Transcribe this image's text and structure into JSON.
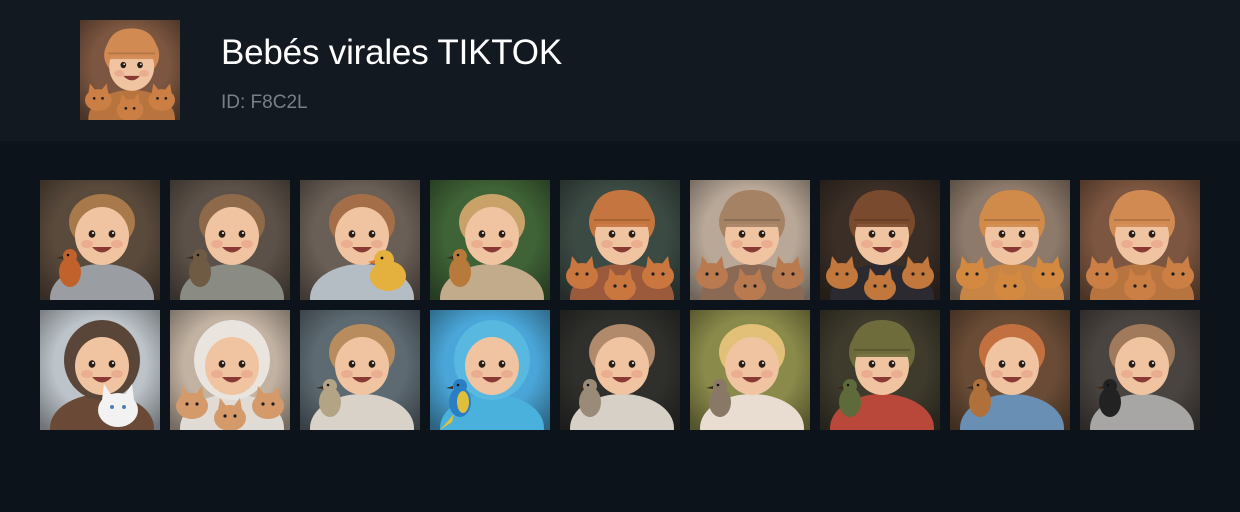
{
  "header": {
    "title": "Bebés virales TIKTOK",
    "id_label": "ID: F8C2L"
  },
  "colors": {
    "page_background": "#0d131a",
    "header_background": "#121920",
    "title_color": "#ffffff",
    "id_color": "#7a7f86"
  },
  "images": [
    {
      "name": "baby-robin",
      "bg": "#5a4a3c",
      "hat": "none",
      "hatColor": "#000000",
      "hair": "#a7794b",
      "cloth": "#9a9da2",
      "animal": "bird",
      "animalColor": "#c1612c"
    },
    {
      "name": "baby-sparrow-hat-none",
      "bg": "#5c5148",
      "hat": "none",
      "hatColor": "#000000",
      "hair": "#8f6a4a",
      "cloth": "#8a8b82",
      "animal": "bird",
      "animalColor": "#6f5a44"
    },
    {
      "name": "baby-chick",
      "bg": "#6a5f56",
      "hat": "none",
      "hatColor": "#000000",
      "hair": "#a46f48",
      "cloth": "#b4bcc4",
      "animal": "chick",
      "animalColor": "#e5b13e"
    },
    {
      "name": "baby-finch-garden",
      "bg": "#3f6236",
      "hat": "none",
      "hatColor": "#000000",
      "hair": "#c9a26a",
      "cloth": "#c2ab8a",
      "animal": "bird",
      "animalColor": "#b87a3a"
    },
    {
      "name": "baby-orange-hat-kittens-snow",
      "bg": "#3c4a44",
      "hat": "beanie",
      "hatColor": "#c5753f",
      "hair": "#c5753f",
      "cloth": "#9c5a3c",
      "animal": "kittens",
      "animalColor": "#c9773e"
    },
    {
      "name": "baby-furry-hat-kittens",
      "bg": "#b9a898",
      "hat": "beanie",
      "hatColor": "#a58264",
      "hair": "#a58264",
      "cloth": "#8a6a55",
      "animal": "kittens",
      "animalColor": "#b87a4e"
    },
    {
      "name": "baby-brown-beanie-kitten",
      "bg": "#3a2e26",
      "hat": "beanie",
      "hatColor": "#7a4a2e",
      "hair": "#7a4a2e",
      "cloth": "#2a2a30",
      "animal": "kittens",
      "animalColor": "#c2773c"
    },
    {
      "name": "baby-orange-beanie-kittens",
      "bg": "#8d7a6a",
      "hat": "beanie",
      "hatColor": "#d08a4a",
      "hair": "#d08a4a",
      "cloth": "#c98546",
      "animal": "kittens",
      "animalColor": "#d38940"
    },
    {
      "name": "baby-orange-hat-kittens",
      "bg": "#7c5640",
      "hat": "beanie",
      "hatColor": "#d08a52",
      "hair": "#d08a52",
      "cloth": "#b8743e",
      "animal": "kittens",
      "animalColor": "#cc7f44"
    },
    {
      "name": "baby-waving-white-kitten",
      "bg": "#bcc3c9",
      "hat": "hood",
      "hatColor": "#5a4638",
      "hair": "#5a4638",
      "cloth": "#6a4a36",
      "animal": "whitecat",
      "animalColor": "#f2f2f2"
    },
    {
      "name": "baby-white-hood-kitten",
      "bg": "#c2b2a2",
      "hat": "hood",
      "hatColor": "#e9e4de",
      "hair": "#e9e4de",
      "cloth": "#e0dbd4",
      "animal": "kittens",
      "animalColor": "#d49a6a"
    },
    {
      "name": "baby-small-bird",
      "bg": "#5d6a72",
      "hat": "none",
      "hatColor": "#000000",
      "hair": "#b88c5c",
      "cloth": "#d8d2c8",
      "animal": "bird",
      "animalColor": "#b3a486"
    },
    {
      "name": "baby-blue-hood-parrot",
      "bg": "#4aa6d8",
      "hat": "hood",
      "hatColor": "#58b8e0",
      "hair": "#58b8e0",
      "cloth": "#4ab0dc",
      "animal": "parrot",
      "animalColor": "#2a7fc4"
    },
    {
      "name": "baby-dark-bird",
      "bg": "#2f2f2c",
      "hat": "none",
      "hatColor": "#000000",
      "hair": "#b08a6a",
      "cloth": "#d6d0c6",
      "animal": "bird",
      "animalColor": "#9a8a78"
    },
    {
      "name": "baby-sunlit-bird",
      "bg": "#8a8a4a",
      "hat": "none",
      "hatColor": "#000000",
      "hair": "#e2c078",
      "cloth": "#e8ddd0",
      "animal": "bird",
      "animalColor": "#8a7866"
    },
    {
      "name": "baby-green-hat-bird",
      "bg": "#3e3a2c",
      "hat": "beanie",
      "hatColor": "#6d6c3a",
      "hair": "#6d6c3a",
      "cloth": "#b9483a",
      "animal": "bird",
      "animalColor": "#5e6a3a"
    },
    {
      "name": "baby-red-hair-bird",
      "bg": "#6a4c36",
      "hat": "none",
      "hatColor": "#000000",
      "hair": "#c27040",
      "cloth": "#6a8fb4",
      "animal": "bird",
      "animalColor": "#b0703a"
    },
    {
      "name": "baby-black-bird",
      "bg": "#4a4440",
      "hat": "none",
      "hatColor": "#000000",
      "hair": "#a07a5a",
      "cloth": "#a7a6a4",
      "animal": "bird",
      "animalColor": "#222222"
    }
  ]
}
